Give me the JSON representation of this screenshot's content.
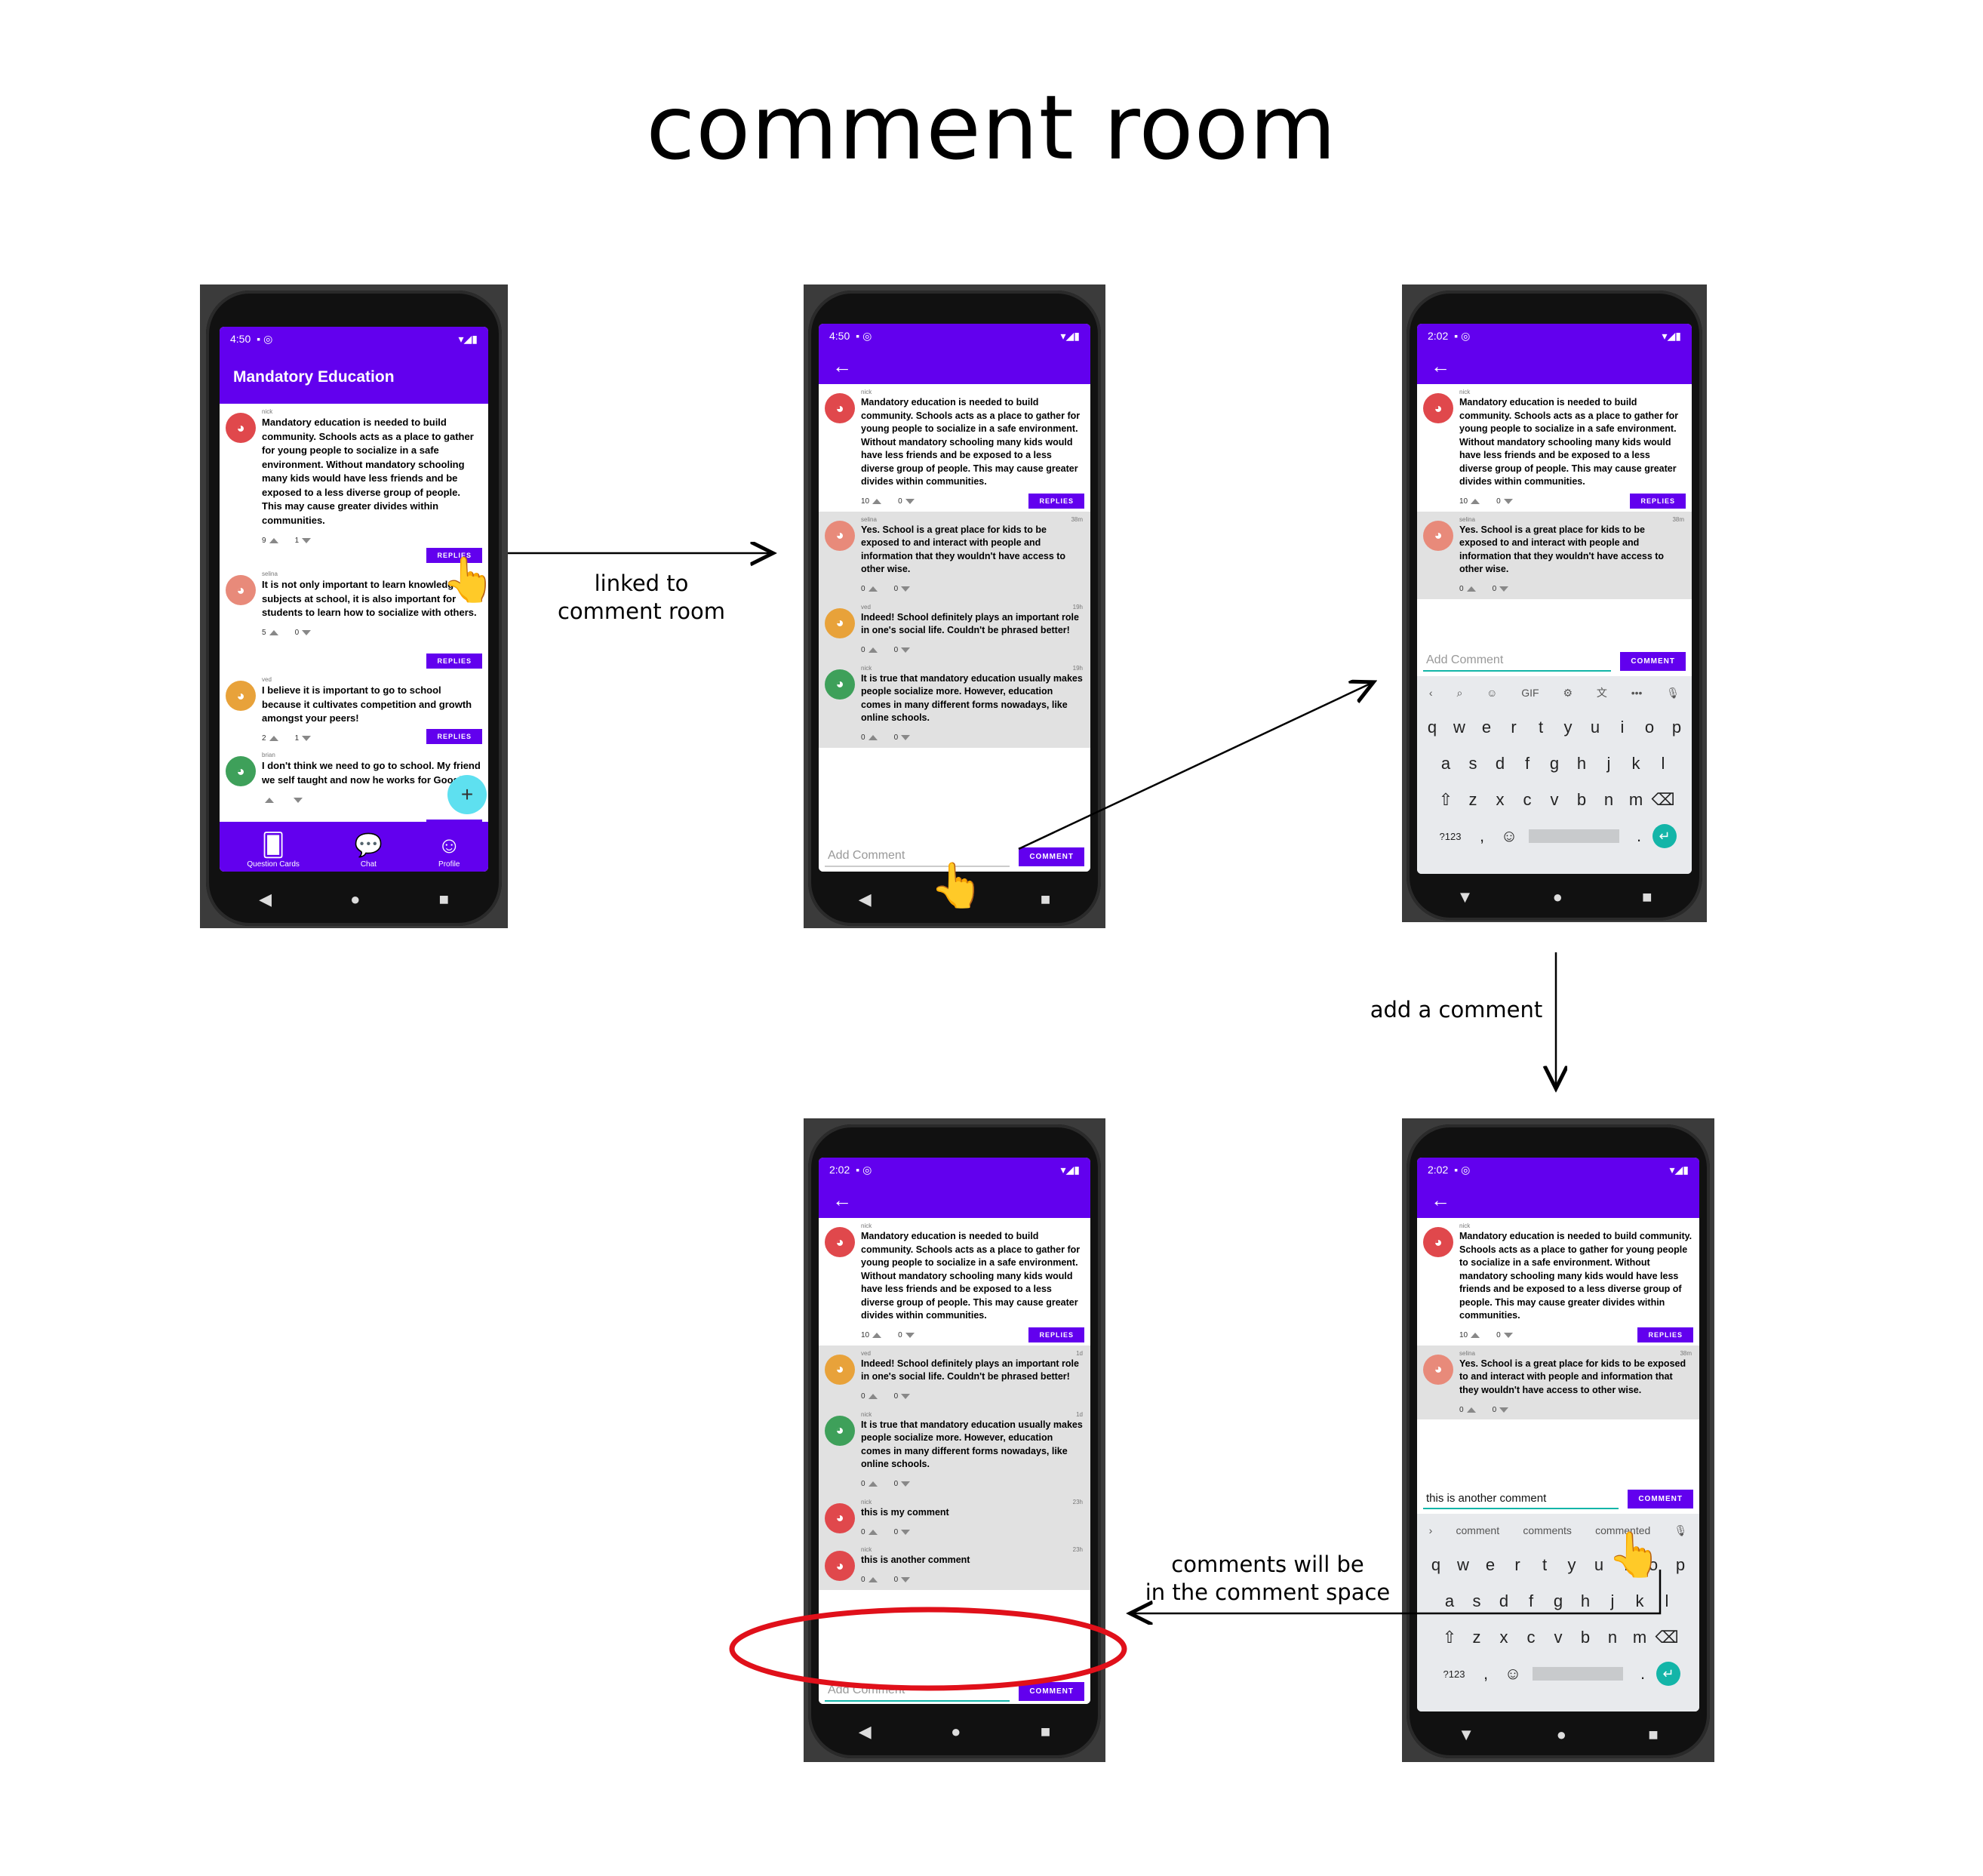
{
  "title": "comment room",
  "labels": {
    "linked": [
      "linked to",
      "comment room"
    ],
    "add": "add a comment",
    "space": [
      "comments will be",
      "in the comment space"
    ]
  },
  "phone1": {
    "time": "4:50",
    "app_title": "Mandatory Education",
    "comments": [
      {
        "user": "nick",
        "text": "Mandatory education is needed to build community. Schools acts as a place to gather for young people to socialize in a safe environment. Without mandatory schooling many kids would have less friends and be exposed to a less diverse group of people. This may cause greater divides within communities.",
        "up": "9",
        "down": "1",
        "color": "#e0484c"
      },
      {
        "user": "selina",
        "text": "It is not only important to learn knowledge on subjects at school, it is also important for students to learn how to socialize with others.",
        "up": "5",
        "down": "0",
        "color": "#e88a7a"
      },
      {
        "user": "ved",
        "text": "I believe it is important to go to school because it cultivates competition and growth amongst your peers!",
        "up": "2",
        "down": "1",
        "color": "#e8a23a"
      },
      {
        "user": "brian",
        "text": "I don't think we need to go to school. My friend we self taught and now he works for Google!",
        "up": "",
        "down": "",
        "color": "#3ea05a"
      }
    ],
    "replies_label": "REPLIES",
    "fab": "+",
    "nav": [
      "Question Cards",
      "Chat",
      "Profile"
    ]
  },
  "phone2": {
    "time": "4:50",
    "comments": [
      {
        "user": "nick",
        "time": "",
        "text": "Mandatory education is needed to build community. Schools acts as a place to gather for young people to socialize in a safe environment. Without mandatory schooling many kids would have less friends and be exposed to a less diverse group of people. This may cause greater divides within communities.",
        "up": "10",
        "down": "0",
        "color": "#e0484c"
      },
      {
        "user": "selina",
        "time": "38m",
        "text": "Yes. School is a great place for kids to be exposed to and interact with people and information that they wouldn't have access to other wise.",
        "up": "0",
        "down": "0",
        "color": "#e88a7a"
      },
      {
        "user": "ved",
        "time": "19h",
        "text": "Indeed! School definitely plays an important role in one's social life. Couldn't be phrased better!",
        "up": "0",
        "down": "0",
        "color": "#e8a23a"
      },
      {
        "user": "nick",
        "time": "19h",
        "text": "It is true that mandatory education usually makes people socialize more. However, education comes in many different forms nowadays, like online schools.",
        "up": "0",
        "down": "0",
        "color": "#3ea05a"
      }
    ],
    "placeholder": "Add Comment",
    "comment_btn": "COMMENT"
  },
  "phone3": {
    "time": "2:02",
    "comments": [
      {
        "user": "nick",
        "time": "",
        "text": "Mandatory education is needed to build community. Schools acts as a place to gather for young people to socialize in a safe environment. Without mandatory schooling many kids would have less friends and be exposed to a less diverse group of people. This may cause greater divides within communities.",
        "up": "10",
        "down": "0",
        "color": "#e0484c"
      },
      {
        "user": "selina",
        "time": "38m",
        "text": "Yes. School is a great place for kids to be exposed to and interact with people and information that they wouldn't have access to other wise.",
        "up": "0",
        "down": "0",
        "color": "#e88a7a"
      }
    ],
    "placeholder": "Add Comment",
    "comment_btn": "COMMENT",
    "toolbar": [
      "‹",
      "⌕",
      "☺",
      "GIF",
      "⚙",
      "文",
      "•••",
      "🎙"
    ],
    "rows": [
      [
        "q",
        "w",
        "e",
        "r",
        "t",
        "y",
        "u",
        "i",
        "o",
        "p"
      ],
      [
        "a",
        "s",
        "d",
        "f",
        "g",
        "h",
        "j",
        "k",
        "l"
      ],
      [
        "⇧",
        "z",
        "x",
        "c",
        "v",
        "b",
        "n",
        "m",
        "⌫"
      ],
      [
        "?123",
        ",",
        "☺",
        "",
        ".",
        "↵"
      ]
    ]
  },
  "phone4": {
    "time": "2:02",
    "comments": [
      {
        "user": "nick",
        "time": "",
        "text": "Mandatory education is needed to build community. Schools acts as a place to gather for young people to socialize in a safe environment. Without mandatory schooling many kids would have less friends and be exposed to a less diverse group of people. This may cause greater divides within communities.",
        "up": "10",
        "down": "0",
        "color": "#e0484c"
      },
      {
        "user": "ved",
        "time": "1d",
        "text": "Indeed! School definitely plays an important role in one's social life. Couldn't be phrased better!",
        "up": "0",
        "down": "0",
        "color": "#e8a23a"
      },
      {
        "user": "nick",
        "time": "1d",
        "text": "It is true that mandatory education usually makes people socialize more. However, education comes in many different forms nowadays, like online schools.",
        "up": "0",
        "down": "0",
        "color": "#3ea05a"
      },
      {
        "user": "nick",
        "time": "23h",
        "text": "this is my comment",
        "up": "0",
        "down": "0",
        "color": "#e0484c"
      },
      {
        "user": "nick",
        "time": "23h",
        "text": "this is another comment",
        "up": "0",
        "down": "0",
        "color": "#e0484c"
      }
    ],
    "placeholder": "Add Comment",
    "comment_btn": "COMMENT"
  },
  "phone5": {
    "time": "2:02",
    "comments": [
      {
        "user": "nick",
        "time": "",
        "text": "Mandatory education is needed to build community. Schools acts as a place to gather for young people to socialize in a safe environment. Without mandatory schooling many kids would have less friends and be exposed to a less diverse group of people. This may cause greater divides within communities.",
        "up": "10",
        "down": "0",
        "color": "#e0484c"
      },
      {
        "user": "selina",
        "time": "38m",
        "text": "Yes. School is a great place for kids to be exposed to and interact with people and information that they wouldn't have access to other wise.",
        "up": "0",
        "down": "0",
        "color": "#e88a7a"
      }
    ],
    "input_value": "this is another comment",
    "comment_btn": "COMMENT",
    "suggestions": [
      "comment",
      "comments",
      "commented"
    ],
    "rows": [
      [
        "q",
        "w",
        "e",
        "r",
        "t",
        "y",
        "u",
        "i",
        "o",
        "p"
      ],
      [
        "a",
        "s",
        "d",
        "f",
        "g",
        "h",
        "j",
        "k",
        "l"
      ],
      [
        "⇧",
        "z",
        "x",
        "c",
        "v",
        "b",
        "n",
        "m",
        "⌫"
      ],
      [
        "?123",
        ",",
        "☺",
        "",
        ".",
        "↵"
      ]
    ]
  },
  "colors": {
    "primary": "#6200ee",
    "accent": "#13b5a8",
    "highlight": "#e0101a"
  }
}
